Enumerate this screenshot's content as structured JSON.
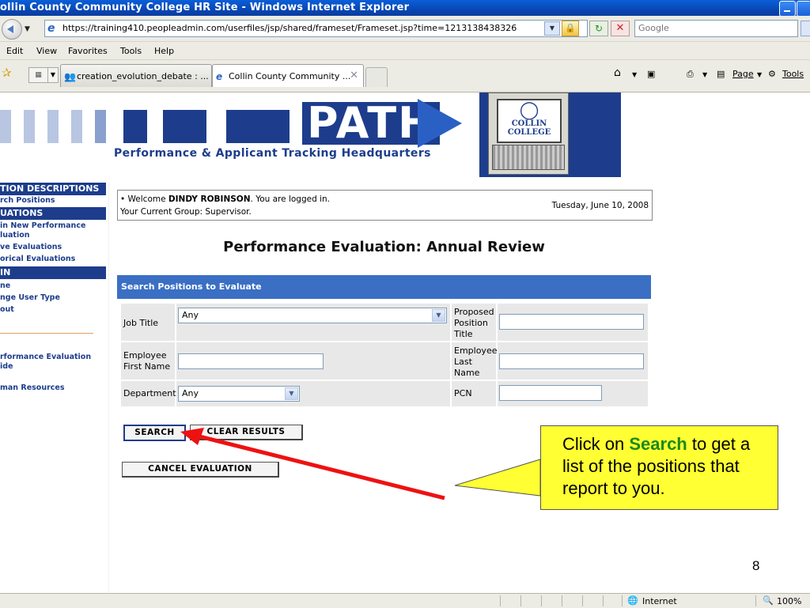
{
  "window": {
    "title": "ollin County Community College HR Site - Windows Internet Explorer"
  },
  "browser": {
    "url": "https://training410.peopleadmin.com/userfiles/jsp/shared/frameset/Frameset.jsp?time=1213138438326",
    "search_placeholder": "Google",
    "menu": [
      "Edit",
      "View",
      "Favorites",
      "Tools",
      "Help"
    ],
    "tabs": [
      {
        "label": "creation_evolution_debate : ...",
        "active": false
      },
      {
        "label": "Collin County Community ...",
        "active": true
      }
    ],
    "toolbar": {
      "page_label": "Page",
      "tools_label": "Tools"
    },
    "status": {
      "zone": "Internet",
      "zoom": "100%"
    }
  },
  "banner": {
    "logo_word": "PATH",
    "tagline": "Performance & Applicant Tracking Headquarters",
    "college_line1": "COLLIN",
    "college_line2": "COLLEGE"
  },
  "leftnav": {
    "section1": "TION DESCRIPTIONS",
    "section1_items": [
      "rch Positions"
    ],
    "section2": "UATIONS",
    "section2_items": [
      "in New Performance",
      "luation",
      "ve Evaluations",
      "orical Evaluations"
    ],
    "section3": "IN",
    "section3_items": [
      "ne",
      "nge User Type",
      "out"
    ],
    "extra_items": [
      "rformance Evaluation",
      "ide",
      "man Resources"
    ]
  },
  "welcome": {
    "prefix": "• Welcome",
    "user": "DINDY ROBINSON",
    "suffix": ". You are logged in.",
    "group": "Your Current Group: Supervisor.",
    "date": "Tuesday, June 10, 2008"
  },
  "page_title": "Performance Evaluation: Annual Review",
  "search_section": {
    "title": "Search Positions to Evaluate",
    "job_title_label": "Job Title",
    "job_title_value": "Any",
    "proposed_label_1": "Proposed",
    "proposed_label_2": "Position",
    "proposed_label_3": "Title",
    "emp_first_label_1": "Employee",
    "emp_first_label_2": "First Name",
    "emp_last_label_1": "Employee",
    "emp_last_label_2": "Last",
    "emp_last_label_3": "Name",
    "department_label": "Department",
    "department_value": "Any",
    "pcn_label": "PCN"
  },
  "buttons": {
    "search": "SEARCH",
    "clear": "CLEAR RESULTS",
    "cancel": "CANCEL EVALUATION"
  },
  "callout": {
    "before": "Click on ",
    "keyword": "Search",
    "after": " to get a list of the positions that report to you."
  },
  "slide_number": "8",
  "colors": {
    "navy": "#1d3d8c",
    "section_blue": "#3a6fc4",
    "callout_yellow": "#ffff33",
    "arrow_red": "#ee1111"
  }
}
